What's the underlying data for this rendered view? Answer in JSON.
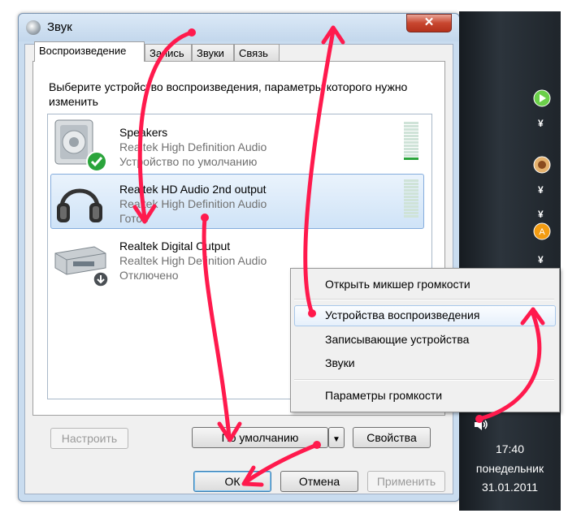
{
  "dialog": {
    "title": "Звук",
    "close_label": "✕",
    "tabs": [
      "Воспроизведение",
      "Запись",
      "Звуки",
      "Связь"
    ],
    "instruction": "Выберите устройство воспроизведения, параметры которого нужно изменить",
    "devices": [
      {
        "name": "Speakers",
        "driver": "Realtek High Definition Audio",
        "status": "Устройство по умолчанию"
      },
      {
        "name": "Realtek HD Audio 2nd output",
        "driver": "Realtek High Definition Audio",
        "status": "Готов"
      },
      {
        "name": "Realtek Digital Output",
        "driver": "Realtek High Definition Audio",
        "status": "Отключено"
      }
    ],
    "buttons": {
      "configure": "Настроить",
      "default": "По умолчанию",
      "properties": "Свойства",
      "ok": "ОК",
      "cancel": "Отмена",
      "apply": "Применить"
    }
  },
  "context_menu": {
    "items": [
      "Открыть микшер громкости",
      "Устройства воспроизведения",
      "Записывающие устройства",
      "Звуки",
      "Параметры громкости"
    ]
  },
  "taskbar": {
    "time": "17:40",
    "day": "понедельник",
    "date": "31.01.2011"
  },
  "annotation_color": "#ff1a4d"
}
